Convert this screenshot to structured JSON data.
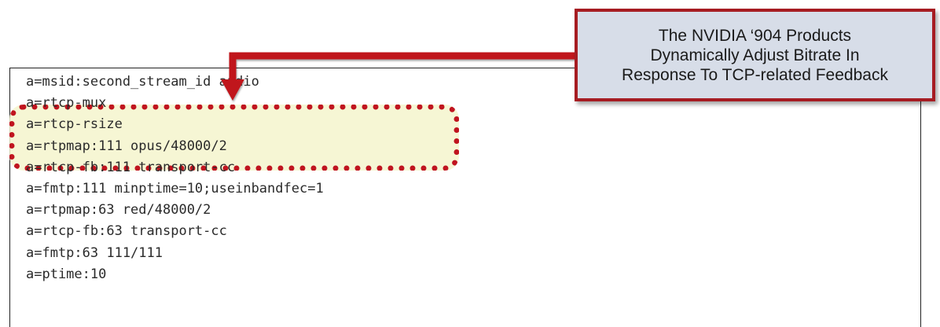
{
  "code": {
    "lines": [
      "a=msid:second_stream_id audio",
      "a=rtcp-mux",
      "a=rtcp-rsize",
      "a=rtpmap:111 opus/48000/2",
      "a=rtcp-fb:111 transport-cc",
      "a=fmtp:111 minptime=10;useinbandfec=1",
      "a=rtpmap:63 red/48000/2",
      "a=rtcp-fb:63 transport-cc",
      "a=fmtp:63 111/111",
      "a=ptime:10"
    ]
  },
  "callout": {
    "text": "The NVIDIA ‘904 Products\nDynamically Adjust Bitrate In\nResponse To TCP-related Feedback"
  },
  "colors": {
    "highlight_border": "#c0141f",
    "highlight_fill": "#f4f4cd",
    "callout_fill": "#d7dde8",
    "callout_border": "#a61c22"
  }
}
